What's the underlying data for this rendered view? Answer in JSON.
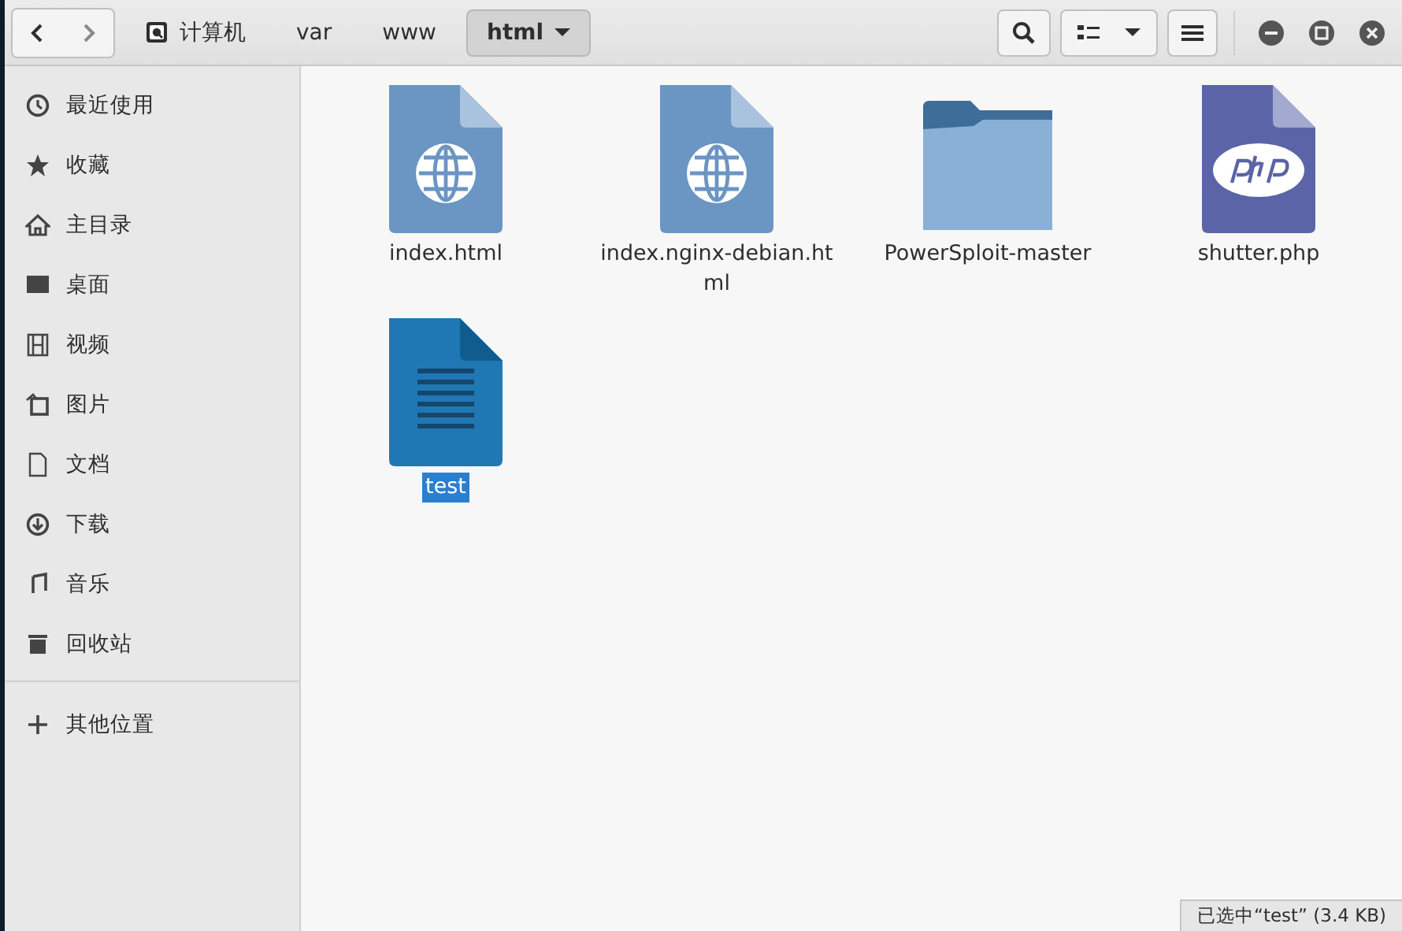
{
  "toolbar": {
    "breadcrumbs": [
      {
        "label": "计算机",
        "kind": "root",
        "selected": false
      },
      {
        "label": "var",
        "kind": "dir",
        "selected": false
      },
      {
        "label": "www",
        "kind": "dir",
        "selected": false
      },
      {
        "label": "html",
        "kind": "dir",
        "selected": true
      }
    ]
  },
  "sidebar": {
    "items": [
      {
        "label": "最近使用"
      },
      {
        "label": "收藏"
      },
      {
        "label": "主目录"
      },
      {
        "label": "桌面"
      },
      {
        "label": "视频"
      },
      {
        "label": "图片"
      },
      {
        "label": "文档"
      },
      {
        "label": "下载"
      },
      {
        "label": "音乐"
      },
      {
        "label": "回收站"
      }
    ],
    "other": {
      "label": "其他位置"
    }
  },
  "files": [
    {
      "name": "index.html",
      "kind": "web",
      "selected": false
    },
    {
      "name": "index.nginx-debian.html",
      "kind": "web",
      "selected": false
    },
    {
      "name": "PowerSploit-master",
      "kind": "folder",
      "selected": false
    },
    {
      "name": "shutter.php",
      "kind": "php",
      "selected": false
    },
    {
      "name": "test",
      "kind": "text",
      "selected": true
    }
  ],
  "status_bar": {
    "text": "已选中“test” (3.4 KB)"
  }
}
